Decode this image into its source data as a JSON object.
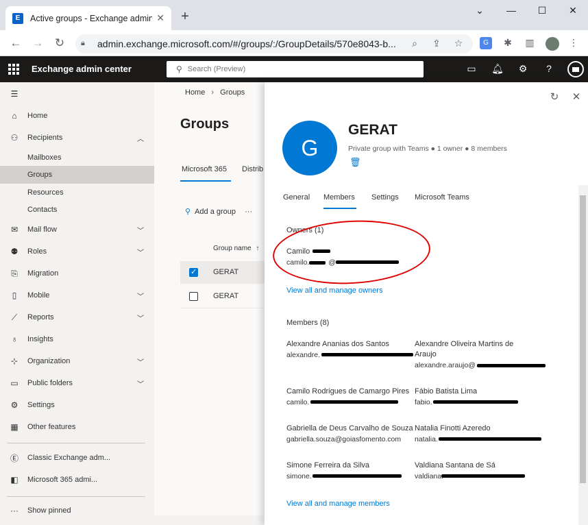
{
  "browser": {
    "tab_title": "Active groups - Exchange admin",
    "tab_favicon": "E",
    "url": "admin.exchange.microsoft.com/#/groups/:/GroupDetails/570e8043-b..."
  },
  "app": {
    "name": "Exchange admin center",
    "search_placeholder": "Search (Preview)"
  },
  "nav": {
    "home": "Home",
    "recipients": "Recipients",
    "mailboxes": "Mailboxes",
    "groups": "Groups",
    "resources": "Resources",
    "contacts": "Contacts",
    "mailflow": "Mail flow",
    "roles": "Roles",
    "migration": "Migration",
    "mobile": "Mobile",
    "reports": "Reports",
    "insights": "Insights",
    "organization": "Organization",
    "publicfolders": "Public folders",
    "settings": "Settings",
    "otherfeatures": "Other features",
    "classic": "Classic Exchange adm...",
    "m365admin": "Microsoft 365 admi...",
    "showpinned": "Show pinned"
  },
  "page": {
    "breadcrumb_home": "Home",
    "breadcrumb_groups": "Groups",
    "title": "Groups",
    "tab_m365": "Microsoft 365",
    "tab_distrib": "Distrib",
    "add_group": "Add a group",
    "more": "···",
    "col_group_name": "Group name",
    "rows": [
      "GERAT",
      "GERAT"
    ]
  },
  "panel": {
    "initial": "G",
    "group_name": "GERAT",
    "meta": "Private group with Teams  ● 1 owner  ● 8 members",
    "tabs": {
      "general": "General",
      "members": "Members",
      "settings": "Settings",
      "teams": "Microsoft Teams"
    },
    "owners_heading": "Owners (1)",
    "owner_name": "Camilo",
    "owner_email": "camilo.",
    "owner_email_at": "@",
    "view_owners": "View all and manage owners",
    "members_heading": "Members (8)",
    "members": [
      {
        "name": "Alexandre Ananias dos Santos",
        "email": "alexandre."
      },
      {
        "name": "Alexandre Oliveira Martins de",
        "name2": "Araujo",
        "email": "alexandre.araujo@"
      },
      {
        "name": "Camilo Rodrigues de Camargo Pires",
        "email": "camilo."
      },
      {
        "name": "Fábio Batista Lima",
        "email": "fabio."
      },
      {
        "name": "Gabriella de Deus Carvalho de Souza",
        "email": "gabriella.souza@goiasfomento.com"
      },
      {
        "name": "Natalia Finotti Azeredo",
        "email": "natalia."
      },
      {
        "name": "Simone Ferreira da Silva",
        "email": "simone."
      },
      {
        "name": "Valdiana Santana de Sá",
        "email": "valdiana."
      }
    ],
    "view_members": "View all and manage members"
  },
  "colors": {
    "accent": "#0078d4",
    "header_bg": "#1b1a19",
    "annotation": "#e00000"
  }
}
